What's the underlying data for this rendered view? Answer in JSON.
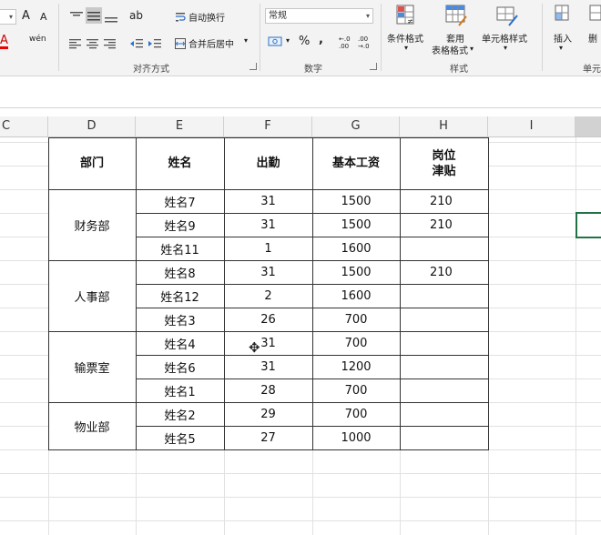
{
  "ribbon": {
    "font_grow_label": "A",
    "font_shrink_label": "A",
    "font_color_label": "A",
    "phonetic_label": "wén",
    "orientation_label": "ab",
    "wrap_text_label": "自动换行",
    "merge_center_label": "合并后居中",
    "alignment_group_label": "对齐方式",
    "number_format_value": "常规",
    "percent_label": "%",
    "comma_label": ",",
    "inc_decimal_label": "←.0 .00",
    "dec_decimal_label": ".00 →.0",
    "number_group_label": "数字",
    "conditional_format_label": "条件格式",
    "format_table_label_line1": "套用",
    "format_table_label_line2": "表格格式",
    "cell_styles_label": "单元格样式",
    "styles_group_label": "样式",
    "insert_label": "插入",
    "delete_label": "删",
    "cells_group_label": "单元"
  },
  "columns": [
    "C",
    "D",
    "E",
    "F",
    "G",
    "H",
    "I"
  ],
  "table": {
    "headers": {
      "dept": "部门",
      "name": "姓名",
      "attendance": "出勤",
      "salary": "基本工资",
      "allowance_line1": "岗位",
      "allowance_line2": "津贴"
    },
    "groups": [
      {
        "dept": "财务部",
        "rows": [
          {
            "name": "姓名7",
            "attendance": "31",
            "salary": "1500",
            "allowance": "210"
          },
          {
            "name": "姓名9",
            "attendance": "31",
            "salary": "1500",
            "allowance": "210"
          },
          {
            "name": "姓名11",
            "attendance": "1",
            "salary": "1600",
            "allowance": ""
          }
        ]
      },
      {
        "dept": "人事部",
        "rows": [
          {
            "name": "姓名8",
            "attendance": "31",
            "salary": "1500",
            "allowance": "210"
          },
          {
            "name": "姓名12",
            "attendance": "2",
            "salary": "1600",
            "allowance": ""
          },
          {
            "name": "姓名3",
            "attendance": "26",
            "salary": "700",
            "allowance": ""
          }
        ]
      },
      {
        "dept": "输票室",
        "rows": [
          {
            "name": "姓名4",
            "attendance": "31",
            "salary": "700",
            "allowance": ""
          },
          {
            "name": "姓名6",
            "attendance": "31",
            "salary": "1200",
            "allowance": ""
          },
          {
            "name": "姓名1",
            "attendance": "28",
            "salary": "700",
            "allowance": ""
          }
        ]
      },
      {
        "dept": "物业部",
        "rows": [
          {
            "name": "姓名2",
            "attendance": "29",
            "salary": "700",
            "allowance": ""
          },
          {
            "name": "姓名5",
            "attendance": "27",
            "salary": "1000",
            "allowance": ""
          }
        ]
      }
    ]
  },
  "colors": {
    "selection": "#217346",
    "ribbon_bg": "#f3f3f3",
    "border": "#333333"
  },
  "icons": [
    "align-left-icon",
    "align-center-icon",
    "align-right-icon",
    "indent-decrease-icon",
    "indent-increase-icon",
    "wrap-text-icon",
    "merge-icon",
    "currency-icon",
    "conditional-format-icon",
    "table-format-icon",
    "cell-styles-icon",
    "insert-icon",
    "move-cursor-icon"
  ]
}
